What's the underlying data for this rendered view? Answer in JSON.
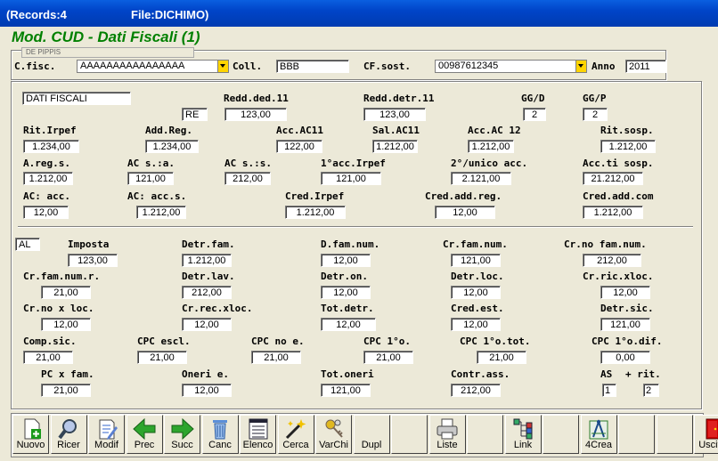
{
  "window": {
    "records": "(Records:4",
    "file": "File:DICHIMO)"
  },
  "form_title": "Mod. CUD - Dati Fiscali (1)",
  "header": {
    "tab_label": "DE PIPPIS",
    "cfisc_label": "C.fisc.",
    "cfisc_value": "AAAAAAAAAAAAAAAA",
    "coll_label": "Coll.",
    "coll_value": "BBB",
    "cfsost_label": "CF.sost.",
    "cfsost_value": "00987612345",
    "anno_label": "Anno",
    "anno_value": "2011"
  },
  "section1": {
    "dati_fiscali": "DATI FISCALI",
    "re": "RE",
    "labels": {
      "redd_ded": "Redd.ded.11",
      "redd_detr": "Redd.detr.11",
      "ggd": "GG/D",
      "ggp": "GG/P",
      "rit_irpef": "Rit.Irpef",
      "add_reg": "Add.Reg.",
      "acc_ac11": "Acc.AC11",
      "sal_ac11": "Sal.AC11",
      "acc_ac12": "Acc.AC 12",
      "rit_sosp": "Rit.sosp.",
      "areg_s": "A.reg.s.",
      "ac_sa": "AC s.:a.",
      "ac_ss": "AC s.:s.",
      "first_acc_irpef": "1°acc.Irpef",
      "second_unico": "2°/unico acc.",
      "acc_ti_sosp": "Acc.ti sosp.",
      "ac_acc": "AC: acc.",
      "ac_accs": "AC: acc.s.",
      "cred_irpef": "Cred.Irpef",
      "cred_add_reg": "Cred.add.reg.",
      "cred_add_com": "Cred.add.com"
    },
    "values": {
      "redd_ded": "123,00",
      "redd_detr": "123,00",
      "ggd": "2",
      "ggp": "2",
      "rit_irpef": "1.234,00",
      "add_reg": "1.234,00",
      "acc_ac11": "122,00",
      "sal_ac11": "1.212,00",
      "acc_ac12": "1.212,00",
      "rit_sosp": "1.212,00",
      "areg_s": "1.212,00",
      "ac_sa": "121,00",
      "ac_ss": "212,00",
      "first_acc_irpef": "121,00",
      "second_unico": "2.121,00",
      "acc_ti_sosp": "21.212,00",
      "ac_acc": "12,00",
      "ac_accs": "1.212,00",
      "cred_irpef": "1.212,00",
      "cred_add_reg": "12,00",
      "cred_add_com": "1.212,00"
    }
  },
  "section2": {
    "al": "AL",
    "labels": {
      "imposta": "Imposta",
      "detr_fam": "Detr.fam.",
      "d_fam_num": "D.fam.num.",
      "cr_fam_num": "Cr.fam.num.",
      "cr_no_fam_num": "Cr.no fam.num.",
      "cr_fam_num_r": "Cr.fam.num.r.",
      "detr_lav": "Detr.lav.",
      "detr_on": "Detr.on.",
      "detr_loc": "Detr.loc.",
      "cr_ric_xloc": "Cr.ric.xloc.",
      "cr_no_x_loc": "Cr.no x loc.",
      "cr_rec_xloc": "Cr.rec.xloc.",
      "tot_detr": "Tot.detr.",
      "cred_est": "Cred.est.",
      "detr_sic": "Detr.sic.",
      "comp_sic": "Comp.sic.",
      "cpc_escl": "CPC escl.",
      "cpc_no_e": "CPC no e.",
      "cpc_1o": "CPC 1°o.",
      "cpc_1o_tot": "CPC 1°o.tot.",
      "cpc_1o_dif": "CPC 1°o.dif.",
      "pc_x_fam": "PC x fam.",
      "oneri_e": "Oneri e.",
      "tot_oneri": "Tot.oneri",
      "contr_ass": "Contr.ass.",
      "as": "AS",
      "rit": "+ rit."
    },
    "values": {
      "imposta": "123,00",
      "detr_fam": "1.212,00",
      "d_fam_num": "12,00",
      "cr_fam_num": "121,00",
      "cr_no_fam_num": "212,00",
      "cr_fam_num_r": "21,00",
      "detr_lav": "212,00",
      "detr_on": "12,00",
      "detr_loc": "12,00",
      "cr_ric_xloc": "12,00",
      "cr_no_x_loc": "12,00",
      "cr_rec_xloc": "12,00",
      "tot_detr": "12,00",
      "cred_est": "12,00",
      "detr_sic": "121,00",
      "comp_sic": "21,00",
      "cpc_escl": "21,00",
      "cpc_no_e": "21,00",
      "cpc_1o": "21,00",
      "cpc_1o_tot": "21,00",
      "cpc_1o_dif": "0,00",
      "pc_x_fam": "21,00",
      "oneri_e": "12,00",
      "tot_oneri": "121,00",
      "contr_ass": "212,00",
      "as": "1",
      "rit": "2"
    }
  },
  "toolbar": [
    {
      "label": "Nuovo",
      "icon": "new-doc-icon"
    },
    {
      "label": "Ricer",
      "icon": "magnifier-icon"
    },
    {
      "label": "Modif",
      "icon": "edit-doc-icon"
    },
    {
      "label": "Prec",
      "icon": "arrow-left-icon"
    },
    {
      "label": "Succ",
      "icon": "arrow-right-icon"
    },
    {
      "label": "Canc",
      "icon": "trash-icon"
    },
    {
      "label": "Elenco",
      "icon": "list-icon"
    },
    {
      "label": "Cerca",
      "icon": "wand-icon"
    },
    {
      "label": "VarChi",
      "icon": "keys-icon"
    },
    {
      "label": "Dupl",
      "icon": ""
    },
    {
      "label": "",
      "icon": ""
    },
    {
      "label": "Liste",
      "icon": "printer-icon"
    },
    {
      "label": "",
      "icon": ""
    },
    {
      "label": "Link",
      "icon": "tree-icon"
    },
    {
      "label": "",
      "icon": ""
    },
    {
      "label": "4Crea",
      "icon": "compass-icon"
    },
    {
      "label": "",
      "icon": ""
    },
    {
      "label": "",
      "icon": ""
    },
    {
      "label": "Uscita",
      "icon": "exit-door-icon"
    }
  ]
}
